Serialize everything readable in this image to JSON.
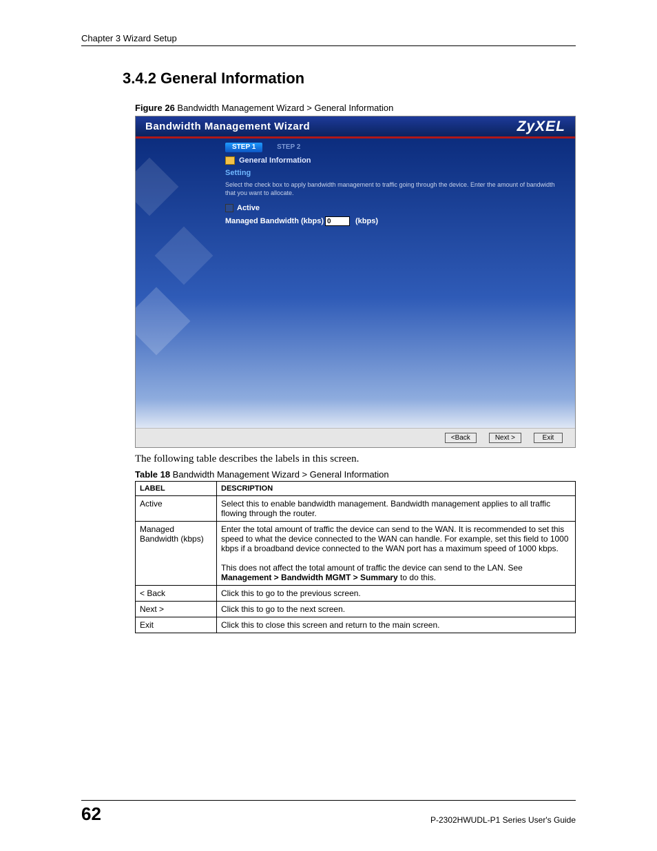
{
  "page": {
    "header": "Chapter 3 Wizard Setup",
    "section_number_title": "3.4.2  General Information",
    "figure_label": "Figure 26",
    "figure_caption": "   Bandwidth Management Wizard > General Information",
    "body_text": "The following table describes the labels in this screen.",
    "table_label": "Table 18",
    "table_caption": "   Bandwidth Management Wizard > General Information",
    "page_number": "62",
    "guide": "P-2302HWUDL-P1 Series User's Guide"
  },
  "wizard": {
    "title": "Bandwidth Management Wizard",
    "logo": "ZyXEL",
    "step1": "STEP 1",
    "step2": "STEP 2",
    "section_title": "General Information",
    "setting_label": "Setting",
    "helper": "Select the check box to apply bandwidth management to traffic going through the device. Enter the amount of bandwidth that you want to allocate.",
    "active_label": "Active",
    "managed_label": "Managed Bandwidth (kbps)",
    "managed_value": "0",
    "unit": "(kbps)",
    "back": "<Back",
    "next": "Next >",
    "exit": "Exit"
  },
  "table": {
    "head_label": "LABEL",
    "head_desc": "DESCRIPTION",
    "rows": [
      {
        "label": "Active",
        "desc": "Select this to enable bandwidth management. Bandwidth management applies to all traffic flowing through the router."
      },
      {
        "label": "Managed Bandwidth (kbps)",
        "desc_plain_1": "Enter the total amount of traffic the device can send to the WAN. It is recommended to set this speed to what the device connected to the WAN can handle. For example, set this field to 1000 kbps if a broadband device connected to the WAN port has a maximum speed of 1000 kbps.",
        "desc_plain_2a": "This does not affect the total amount of traffic the device can send to the LAN. See ",
        "desc_bold": "Management > Bandwidth MGMT > Summary",
        "desc_plain_2b": " to do this."
      },
      {
        "label": "< Back",
        "desc": "Click this to go to the previous screen."
      },
      {
        "label": "Next >",
        "desc": "Click this to go to the next screen."
      },
      {
        "label": "Exit",
        "desc": "Click this to close this screen and return to the main screen."
      }
    ]
  }
}
